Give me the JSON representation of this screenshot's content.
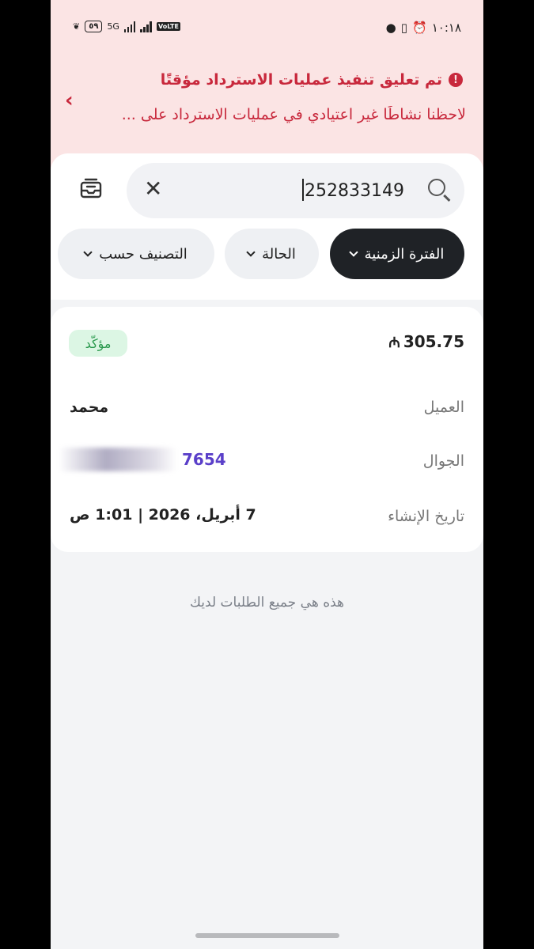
{
  "status_bar": {
    "time": "١٠:١٨",
    "battery": "٥٩",
    "network": "5G",
    "volte": "VoLTE"
  },
  "banner": {
    "title": "تم تعليق تنفيذ عمليات الاسترداد مؤقتًا",
    "text": "لاحظنا نشاطًا غير اعتيادي في عمليات الاسترداد على ...",
    "colors": {
      "bg": "#fbe4e4",
      "text": "#c8283c"
    },
    "icons": {
      "warning": "warning-icon",
      "expand": "chevron-left-icon"
    }
  },
  "search": {
    "value": "252833149",
    "icons": {
      "search": "search-icon",
      "clear": "close-icon",
      "inbox": "inbox-icon"
    }
  },
  "filters": [
    {
      "label": "الفترة الزمنية",
      "active": true
    },
    {
      "label": "الحالة",
      "active": false
    },
    {
      "label": "التصنيف حسب",
      "active": false
    }
  ],
  "order": {
    "amount": "305.75",
    "currency_symbol": "⃁",
    "status": "مؤكّد",
    "customer_label": "العميل",
    "customer_value": "محمد",
    "phone_label": "الجوال",
    "phone_value": "7654",
    "created_label": "تاريخ الإنشاء",
    "created_value": "7 أبريل، 2026 | 1:01 ص",
    "colors": {
      "status_bg": "#dcf6e4",
      "status_text": "#2c9a4f",
      "phone_text": "#5a3fc9"
    }
  },
  "footer_note": "هذه هي جميع الطلبات لديك"
}
